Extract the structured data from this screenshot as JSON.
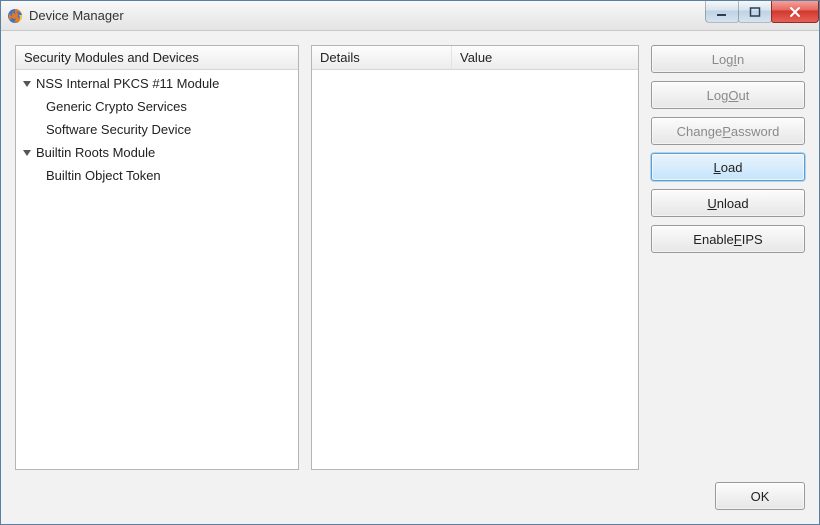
{
  "window": {
    "title": "Device Manager"
  },
  "left": {
    "header": "Security Modules and Devices",
    "modules": [
      {
        "label": "NSS Internal PKCS #11 Module",
        "children": [
          {
            "label": "Generic Crypto Services"
          },
          {
            "label": "Software Security Device"
          }
        ]
      },
      {
        "label": "Builtin Roots Module",
        "children": [
          {
            "label": "Builtin Object Token"
          }
        ]
      }
    ]
  },
  "mid": {
    "headers": {
      "details": "Details",
      "value": "Value"
    }
  },
  "buttons": {
    "login_pre": "Log ",
    "login_m": "I",
    "login_post": "n",
    "logout_pre": "Log ",
    "logout_m": "O",
    "logout_post": "ut",
    "changepw_pre": "Change ",
    "changepw_m": "P",
    "changepw_post": "assword",
    "load_pre": "",
    "load_m": "L",
    "load_post": "oad",
    "unload_pre": "",
    "unload_m": "U",
    "unload_post": "nload",
    "fips_pre": "Enable ",
    "fips_m": "F",
    "fips_post": "IPS",
    "ok": "OK"
  }
}
